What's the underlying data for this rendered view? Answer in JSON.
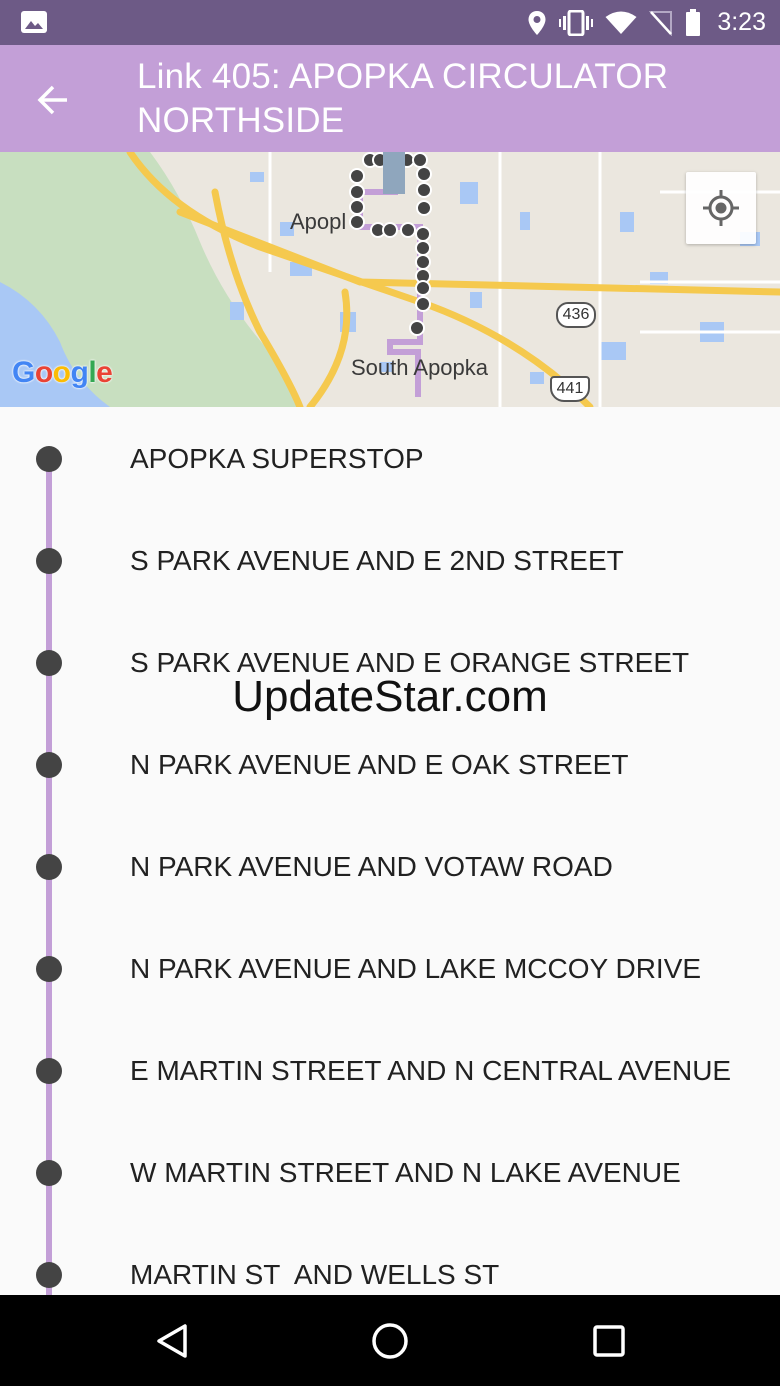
{
  "status_bar": {
    "time": "3:23",
    "icons": [
      "image-icon",
      "location-icon",
      "vibrate-icon",
      "wifi-icon",
      "no-sim-icon",
      "battery-icon"
    ]
  },
  "toolbar": {
    "title": "Link 405: APOPKA CIRCULATOR NORTHSIDE",
    "back_icon": "arrow-back-icon"
  },
  "map": {
    "labels": {
      "apopka": "Apopl",
      "south_apopka": "South Apopka"
    },
    "shields": [
      "436",
      "441"
    ],
    "attribution": [
      "G",
      "o",
      "o",
      "g",
      "l",
      "e"
    ],
    "locate_icon": "my-location-icon",
    "route_color": "#c39fd7"
  },
  "stops": [
    {
      "name": "APOPKA SUPERSTOP"
    },
    {
      "name": "S PARK AVENUE AND E 2ND STREET"
    },
    {
      "name": "S PARK AVENUE AND E ORANGE STREET"
    },
    {
      "name": "N PARK AVENUE AND E OAK STREET"
    },
    {
      "name": "N PARK AVENUE AND VOTAW ROAD"
    },
    {
      "name": "N PARK AVENUE AND LAKE MCCOY DRIVE"
    },
    {
      "name": "E MARTIN STREET AND N CENTRAL AVENUE"
    },
    {
      "name": "W MARTIN STREET AND N LAKE AVENUE"
    },
    {
      "name": "MARTIN ST  AND WELLS ST"
    }
  ],
  "watermark": "UpdateStar.com",
  "nav_bar": [
    "back-triangle-icon",
    "home-circle-icon",
    "recents-square-icon"
  ],
  "colors": {
    "status_bar": "#6d5a86",
    "toolbar": "#c39fd7",
    "stop_dot": "#444444",
    "route_line": "#c39fd7"
  }
}
